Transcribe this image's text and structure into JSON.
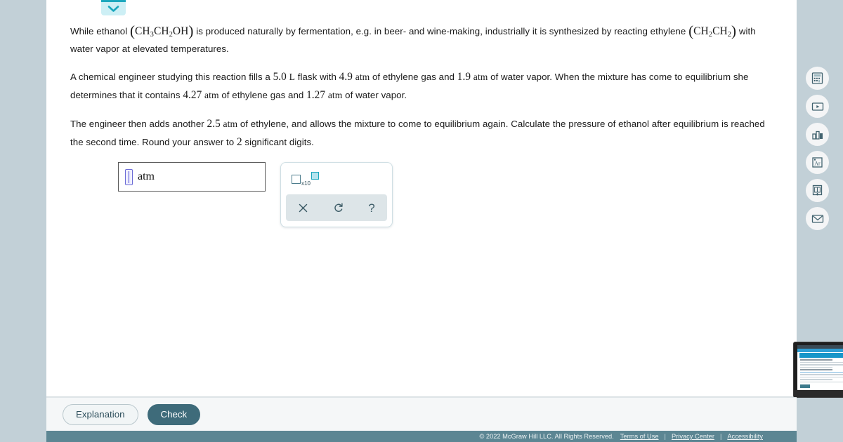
{
  "app": {
    "background_color": "#c2d0d7",
    "panel_color": "#ffffff",
    "accent_color": "#3e6b7a",
    "tab_accent_color": "#1ba7bd"
  },
  "collapse_tab": {
    "icon": "chevron-down-icon",
    "aria_label": "Collapse"
  },
  "problem": {
    "paragraph_1": {
      "t1": "While ethanol ",
      "formula_1_open": "(",
      "formula_1": "CH3CH2OH",
      "formula_1_close": ")",
      "t2": " is produced naturally by fermentation, e.g. in beer- and wine-making, industrially it is synthesized by reacting ethylene ",
      "formula_2_open": "(",
      "formula_2": "CH2CH2",
      "formula_2_close": ")",
      "t3": " with water vapor at elevated temperatures."
    },
    "paragraph_2": {
      "t1": "A chemical engineer studying this reaction fills a ",
      "v1": "5.0",
      "u1": "L",
      "t2": " flask with ",
      "v2": "4.9",
      "u2": "atm",
      "t3": " of ethylene gas and ",
      "v3": "1.9",
      "u3": "atm",
      "t4": " of water vapor. When the mixture has come to equilibrium she determines that it contains ",
      "v4": "4.27",
      "u4": "atm",
      "t5": " of ethylene gas and ",
      "v5": "1.27",
      "u5": "atm",
      "t6": " of water vapor."
    },
    "paragraph_3": {
      "t1": "The engineer then adds another ",
      "v1": "2.5",
      "u1": "atm",
      "t2": " of ethylene, and allows the mixture to come to equilibrium again. Calculate the pressure of ethanol after equilibrium is reached the second time. Round your answer to ",
      "v2": "2",
      "t3": " significant digits."
    }
  },
  "answer": {
    "value": "",
    "placeholder": "",
    "unit_label": "atm"
  },
  "math_palette": {
    "scientific_notation_label": "x10",
    "buttons": [
      {
        "name": "clear-button",
        "icon": "close-icon",
        "label": "×"
      },
      {
        "name": "undo-button",
        "icon": "undo-icon",
        "label": "↺"
      },
      {
        "name": "help-button",
        "icon": "question-icon",
        "label": "?"
      }
    ]
  },
  "tool_rail": [
    {
      "name": "calculator-icon",
      "label": "Calculator"
    },
    {
      "name": "video-icon",
      "label": "Video"
    },
    {
      "name": "bar-chart-icon",
      "label": "Data"
    },
    {
      "name": "periodic-table-icon",
      "label": "Ar"
    },
    {
      "name": "reference-book-icon",
      "label": "Reference"
    },
    {
      "name": "envelope-icon",
      "label": "Message"
    }
  ],
  "action_bar": {
    "explanation_label": "Explanation",
    "check_label": "Check"
  },
  "footer": {
    "copyright": "© 2022 McGraw Hill LLC. All Rights Reserved.",
    "links": [
      {
        "label": "Terms of Use"
      },
      {
        "label": "Privacy Center"
      },
      {
        "label": "Accessibility"
      }
    ],
    "separator": "|"
  }
}
